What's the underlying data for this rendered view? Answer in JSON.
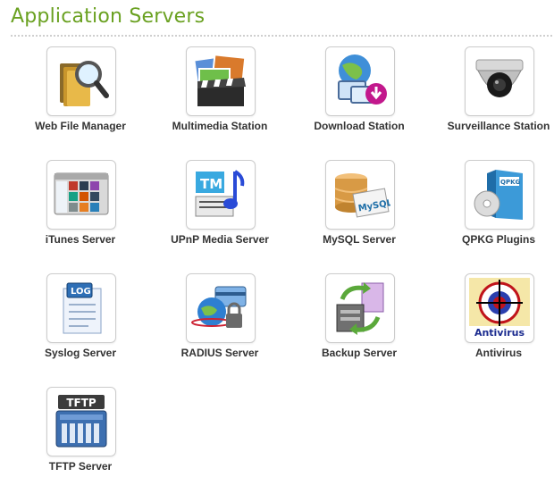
{
  "header": {
    "title": "Application Servers"
  },
  "apps": [
    {
      "label": "Web File Manager",
      "icon": "folder-magnifier-icon"
    },
    {
      "label": "Multimedia Station",
      "icon": "clapperboard-photos-icon"
    },
    {
      "label": "Download Station",
      "icon": "globe-download-icon"
    },
    {
      "label": "Surveillance Station",
      "icon": "dome-camera-icon"
    },
    {
      "label": "iTunes Server",
      "icon": "itunes-window-icon"
    },
    {
      "label": "UPnP Media Server",
      "icon": "upnp-media-icon"
    },
    {
      "label": "MySQL Server",
      "icon": "database-mysql-icon"
    },
    {
      "label": "QPKG Plugins",
      "icon": "qpkg-box-icon"
    },
    {
      "label": "Syslog Server",
      "icon": "log-document-icon"
    },
    {
      "label": "RADIUS Server",
      "icon": "globe-lock-card-icon"
    },
    {
      "label": "Backup Server",
      "icon": "server-backup-icon"
    },
    {
      "label": "Antivirus",
      "icon": "antivirus-crosshair-icon",
      "icon_text": "Antivirus"
    },
    {
      "label": "TFTP Server",
      "icon": "tftp-server-icon",
      "icon_text": "TFTP"
    }
  ]
}
